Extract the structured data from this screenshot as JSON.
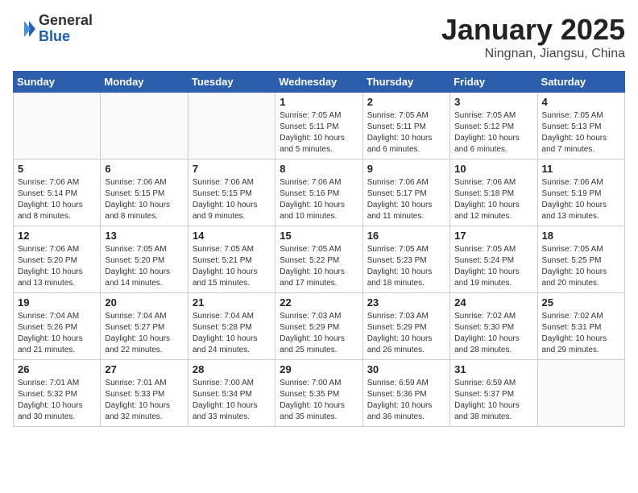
{
  "header": {
    "logo_general": "General",
    "logo_blue": "Blue",
    "month_title": "January 2025",
    "location": "Ningnan, Jiangsu, China"
  },
  "weekdays": [
    "Sunday",
    "Monday",
    "Tuesday",
    "Wednesday",
    "Thursday",
    "Friday",
    "Saturday"
  ],
  "weeks": [
    [
      {
        "day": "",
        "info": ""
      },
      {
        "day": "",
        "info": ""
      },
      {
        "day": "",
        "info": ""
      },
      {
        "day": "1",
        "info": "Sunrise: 7:05 AM\nSunset: 5:11 PM\nDaylight: 10 hours\nand 5 minutes."
      },
      {
        "day": "2",
        "info": "Sunrise: 7:05 AM\nSunset: 5:11 PM\nDaylight: 10 hours\nand 6 minutes."
      },
      {
        "day": "3",
        "info": "Sunrise: 7:05 AM\nSunset: 5:12 PM\nDaylight: 10 hours\nand 6 minutes."
      },
      {
        "day": "4",
        "info": "Sunrise: 7:05 AM\nSunset: 5:13 PM\nDaylight: 10 hours\nand 7 minutes."
      }
    ],
    [
      {
        "day": "5",
        "info": "Sunrise: 7:06 AM\nSunset: 5:14 PM\nDaylight: 10 hours\nand 8 minutes."
      },
      {
        "day": "6",
        "info": "Sunrise: 7:06 AM\nSunset: 5:15 PM\nDaylight: 10 hours\nand 8 minutes."
      },
      {
        "day": "7",
        "info": "Sunrise: 7:06 AM\nSunset: 5:15 PM\nDaylight: 10 hours\nand 9 minutes."
      },
      {
        "day": "8",
        "info": "Sunrise: 7:06 AM\nSunset: 5:16 PM\nDaylight: 10 hours\nand 10 minutes."
      },
      {
        "day": "9",
        "info": "Sunrise: 7:06 AM\nSunset: 5:17 PM\nDaylight: 10 hours\nand 11 minutes."
      },
      {
        "day": "10",
        "info": "Sunrise: 7:06 AM\nSunset: 5:18 PM\nDaylight: 10 hours\nand 12 minutes."
      },
      {
        "day": "11",
        "info": "Sunrise: 7:06 AM\nSunset: 5:19 PM\nDaylight: 10 hours\nand 13 minutes."
      }
    ],
    [
      {
        "day": "12",
        "info": "Sunrise: 7:06 AM\nSunset: 5:20 PM\nDaylight: 10 hours\nand 13 minutes."
      },
      {
        "day": "13",
        "info": "Sunrise: 7:05 AM\nSunset: 5:20 PM\nDaylight: 10 hours\nand 14 minutes."
      },
      {
        "day": "14",
        "info": "Sunrise: 7:05 AM\nSunset: 5:21 PM\nDaylight: 10 hours\nand 15 minutes."
      },
      {
        "day": "15",
        "info": "Sunrise: 7:05 AM\nSunset: 5:22 PM\nDaylight: 10 hours\nand 17 minutes."
      },
      {
        "day": "16",
        "info": "Sunrise: 7:05 AM\nSunset: 5:23 PM\nDaylight: 10 hours\nand 18 minutes."
      },
      {
        "day": "17",
        "info": "Sunrise: 7:05 AM\nSunset: 5:24 PM\nDaylight: 10 hours\nand 19 minutes."
      },
      {
        "day": "18",
        "info": "Sunrise: 7:05 AM\nSunset: 5:25 PM\nDaylight: 10 hours\nand 20 minutes."
      }
    ],
    [
      {
        "day": "19",
        "info": "Sunrise: 7:04 AM\nSunset: 5:26 PM\nDaylight: 10 hours\nand 21 minutes."
      },
      {
        "day": "20",
        "info": "Sunrise: 7:04 AM\nSunset: 5:27 PM\nDaylight: 10 hours\nand 22 minutes."
      },
      {
        "day": "21",
        "info": "Sunrise: 7:04 AM\nSunset: 5:28 PM\nDaylight: 10 hours\nand 24 minutes."
      },
      {
        "day": "22",
        "info": "Sunrise: 7:03 AM\nSunset: 5:29 PM\nDaylight: 10 hours\nand 25 minutes."
      },
      {
        "day": "23",
        "info": "Sunrise: 7:03 AM\nSunset: 5:29 PM\nDaylight: 10 hours\nand 26 minutes."
      },
      {
        "day": "24",
        "info": "Sunrise: 7:02 AM\nSunset: 5:30 PM\nDaylight: 10 hours\nand 28 minutes."
      },
      {
        "day": "25",
        "info": "Sunrise: 7:02 AM\nSunset: 5:31 PM\nDaylight: 10 hours\nand 29 minutes."
      }
    ],
    [
      {
        "day": "26",
        "info": "Sunrise: 7:01 AM\nSunset: 5:32 PM\nDaylight: 10 hours\nand 30 minutes."
      },
      {
        "day": "27",
        "info": "Sunrise: 7:01 AM\nSunset: 5:33 PM\nDaylight: 10 hours\nand 32 minutes."
      },
      {
        "day": "28",
        "info": "Sunrise: 7:00 AM\nSunset: 5:34 PM\nDaylight: 10 hours\nand 33 minutes."
      },
      {
        "day": "29",
        "info": "Sunrise: 7:00 AM\nSunset: 5:35 PM\nDaylight: 10 hours\nand 35 minutes."
      },
      {
        "day": "30",
        "info": "Sunrise: 6:59 AM\nSunset: 5:36 PM\nDaylight: 10 hours\nand 36 minutes."
      },
      {
        "day": "31",
        "info": "Sunrise: 6:59 AM\nSunset: 5:37 PM\nDaylight: 10 hours\nand 38 minutes."
      },
      {
        "day": "",
        "info": ""
      }
    ]
  ]
}
